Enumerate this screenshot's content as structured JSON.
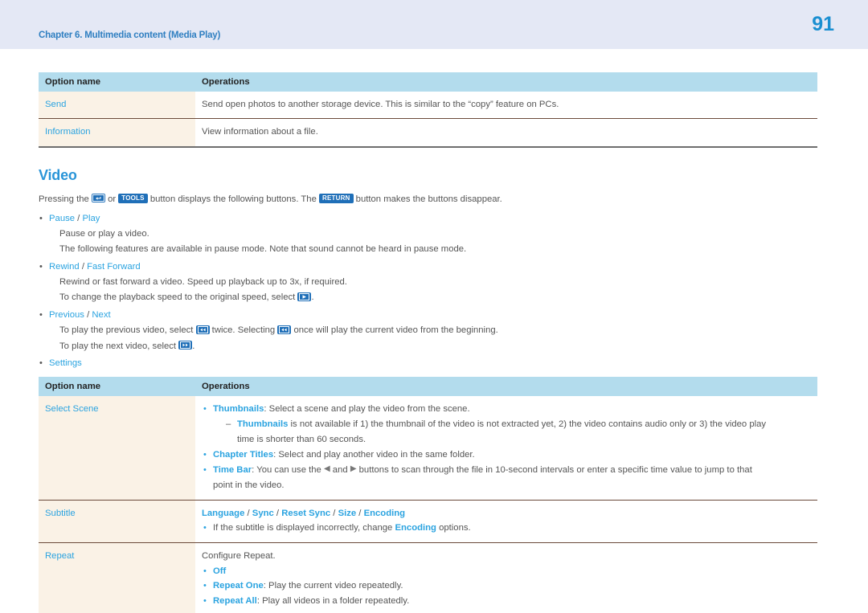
{
  "header": {
    "chapter": "Chapter 6. Multimedia content (Media Play)",
    "page_number": "91",
    "band_color": "#e4e8f5",
    "chapter_color": "#2f7fc1",
    "page_number_color": "#1a8fd1"
  },
  "colors": {
    "accent_blue": "#2aa3e0",
    "heading_blue": "#2a95d8",
    "table_header_bg": "#b3dced",
    "name_cell_bg": "#faf2e6",
    "body_text": "#555555",
    "key_button_bg": "#1f6fb8"
  },
  "table_top": {
    "columns": [
      "Option name",
      "Operations"
    ],
    "rows": [
      {
        "name": "Send",
        "operation": "Send open photos to another storage device. This is similar to the “copy” feature on PCs."
      },
      {
        "name": "Information",
        "operation": "View information about a file."
      }
    ]
  },
  "video_section": {
    "heading": "Video",
    "intro": {
      "part1": "Pressing the ",
      "icon1_name": "enter-select-icon",
      "part2": " or ",
      "key_tools": "TOOLS",
      "part3": " button displays the following buttons. The ",
      "key_return": "RETURN",
      "part4": " button makes the buttons disappear."
    },
    "bullets": [
      {
        "label_a": "Pause",
        "separator": " / ",
        "label_b": "Play",
        "lines": [
          "Pause or play a video.",
          "The following features are available in pause mode. Note that sound cannot be heard in pause mode."
        ]
      },
      {
        "label_a": "Rewind",
        "separator": " / ",
        "label_b": "Fast Forward",
        "lines": [
          "Rewind or fast forward a video. Speed up playback up to 3x, if required."
        ],
        "line_with_icon": {
          "before": "To change the playback speed to the original speed, select ",
          "icon_name": "play-icon",
          "after": "."
        }
      },
      {
        "label_a": "Previous",
        "separator": " / ",
        "label_b": "Next",
        "line_prev": {
          "before": "To play the previous video, select ",
          "icon_name": "previous-icon",
          "middle": " twice. Selecting ",
          "icon2_name": "previous-icon",
          "after": " once will play the current video from the beginning."
        },
        "line_next": {
          "before": "To play the next video, select ",
          "icon_name": "next-icon",
          "after": "."
        }
      },
      {
        "label_a": "Settings"
      }
    ]
  },
  "table_settings": {
    "columns": [
      "Option name",
      "Operations"
    ],
    "rows": [
      {
        "name": "Select Scene",
        "items": [
          {
            "kw": "Thumbnails",
            "text": ": Select a scene and play the video from the scene."
          },
          {
            "dash": true,
            "kw": "Thumbnails",
            "text": " is not available if 1) the thumbnail of the video is not extracted yet, 2) the video contains audio only or 3) the video play",
            "cont": "time is shorter than 60 seconds."
          },
          {
            "kw": "Chapter Titles",
            "text": ": Select and play another video in the same folder."
          },
          {
            "kw": "Time Bar",
            "text_before": ": You can use the ",
            "icon_left": "left-triangle-icon",
            "text_mid": " and ",
            "icon_right": "right-triangle-icon",
            "text_after": " buttons to scan through the file in 10-second intervals or enter a specific time value to jump to that",
            "cont": "point in the video."
          }
        ]
      },
      {
        "name": "Subtitle",
        "options_line": [
          "Language",
          "Sync",
          "Reset Sync",
          "Size",
          "Encoding"
        ],
        "note_before": "If the subtitle is displayed incorrectly, change ",
        "note_kw": "Encoding",
        "note_after": " options."
      },
      {
        "name": "Repeat",
        "intro": "Configure Repeat.",
        "items": [
          {
            "kw": "Off",
            "text": ""
          },
          {
            "kw": "Repeat One",
            "text": ": Play the current video repeatedly."
          },
          {
            "kw": "Repeat All",
            "text": ": Play all videos in a folder repeatedly."
          }
        ]
      }
    ]
  }
}
